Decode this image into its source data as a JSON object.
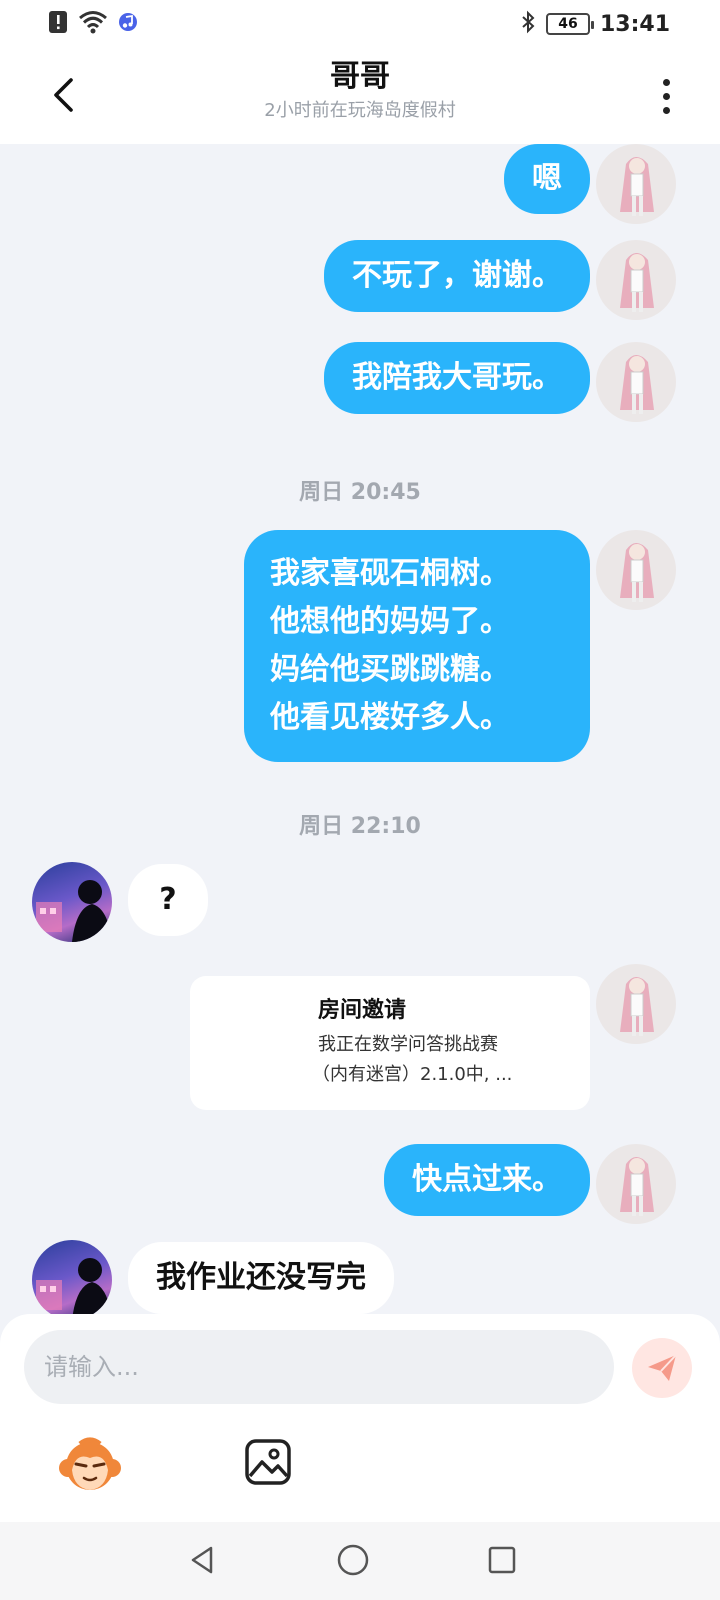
{
  "status_bar": {
    "time": "13:41",
    "battery": "46",
    "icons": [
      "alert-icon",
      "wifi-icon",
      "music-app-icon",
      "bluetooth-icon",
      "battery-icon"
    ]
  },
  "header": {
    "title": "哥哥",
    "subtitle": "2小时前在玩海岛度假村"
  },
  "messages": [
    {
      "side": "me",
      "text": "嗯"
    },
    {
      "side": "me",
      "text": "不玩了，谢谢。"
    },
    {
      "side": "me",
      "text": "我陪我大哥玩。"
    },
    {
      "type": "timestamp",
      "text": "周日 20:45"
    },
    {
      "side": "me",
      "lines": [
        "我家喜砚石桐树。",
        "他想他的妈妈了。",
        "妈给他买跳跳糖。",
        "他看见楼好多人。"
      ]
    },
    {
      "type": "timestamp",
      "text": "周日 22:10"
    },
    {
      "side": "them",
      "text": "?"
    },
    {
      "side": "me",
      "type": "invite",
      "title": "房间邀请",
      "body_line1": "我正在数学问答挑战赛",
      "body_line2": "（内有迷宫）2.1.0中, ..."
    },
    {
      "side": "me",
      "text": "快点过来。"
    },
    {
      "side": "them",
      "text": "我作业还没写完"
    }
  ],
  "input": {
    "placeholder": "请输入..."
  },
  "colors": {
    "bubble_me": "#2ab4fb",
    "bubble_them": "#ffffff",
    "background": "#f1f3f8",
    "send_button_bg": "#ffe6e2",
    "send_icon": "#f59a8a"
  }
}
